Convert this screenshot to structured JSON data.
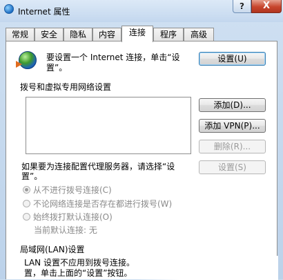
{
  "window": {
    "title": "Internet 属性",
    "help_glyph": "?",
    "close_glyph": "X"
  },
  "tabs": [
    {
      "label": "常规"
    },
    {
      "label": "安全"
    },
    {
      "label": "隐私"
    },
    {
      "label": "内容"
    },
    {
      "label": "连接",
      "active": true
    },
    {
      "label": "程序"
    },
    {
      "label": "高级"
    }
  ],
  "setup": {
    "line1": "要设置一个 Internet 连接，单击“设",
    "line2": "置”。",
    "button": "设置(U)"
  },
  "dialup": {
    "header": "拨号和虚拟专用网络设置",
    "add_button": "添加(D)...",
    "add_vpn_button": "添加 VPN(P)...",
    "delete_button": "删除(R)...",
    "proxy_line1": "如果要为连接配置代理服务器，请选择“设",
    "proxy_line2": "置”。",
    "settings_button": "设置(S)",
    "options": [
      {
        "label": "从不进行拨号连接(C)",
        "checked": true
      },
      {
        "label": "不论网络连接是否存在都进行拨号(W)",
        "checked": false
      },
      {
        "label": "始终拨打默认连接(O)",
        "checked": false
      }
    ],
    "current_default": "当前默认连接: 无"
  },
  "lan": {
    "header": "局域网(LAN)设置",
    "line1": "LAN 设置不应用到拨号连接。",
    "line2": "置，单击上面的“设置”按钮。"
  }
}
